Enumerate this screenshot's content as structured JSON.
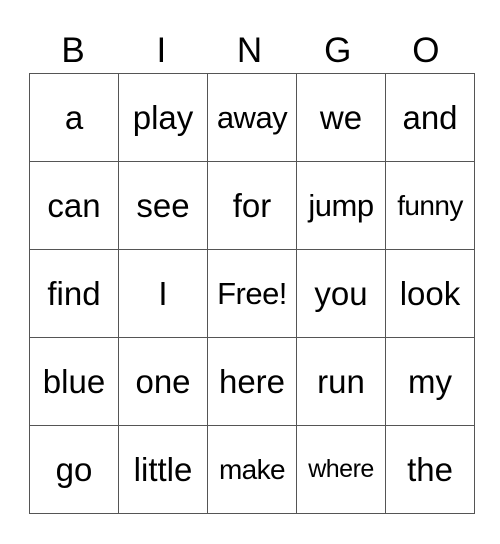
{
  "header": [
    "B",
    "I",
    "N",
    "G",
    "O"
  ],
  "rows": [
    [
      "a",
      "play",
      "away",
      "we",
      "and"
    ],
    [
      "can",
      "see",
      "for",
      "jump",
      "funny"
    ],
    [
      "find",
      "I",
      "Free!",
      "you",
      "look"
    ],
    [
      "blue",
      "one",
      "here",
      "run",
      "my"
    ],
    [
      "go",
      "little",
      "make",
      "where",
      "the"
    ]
  ]
}
